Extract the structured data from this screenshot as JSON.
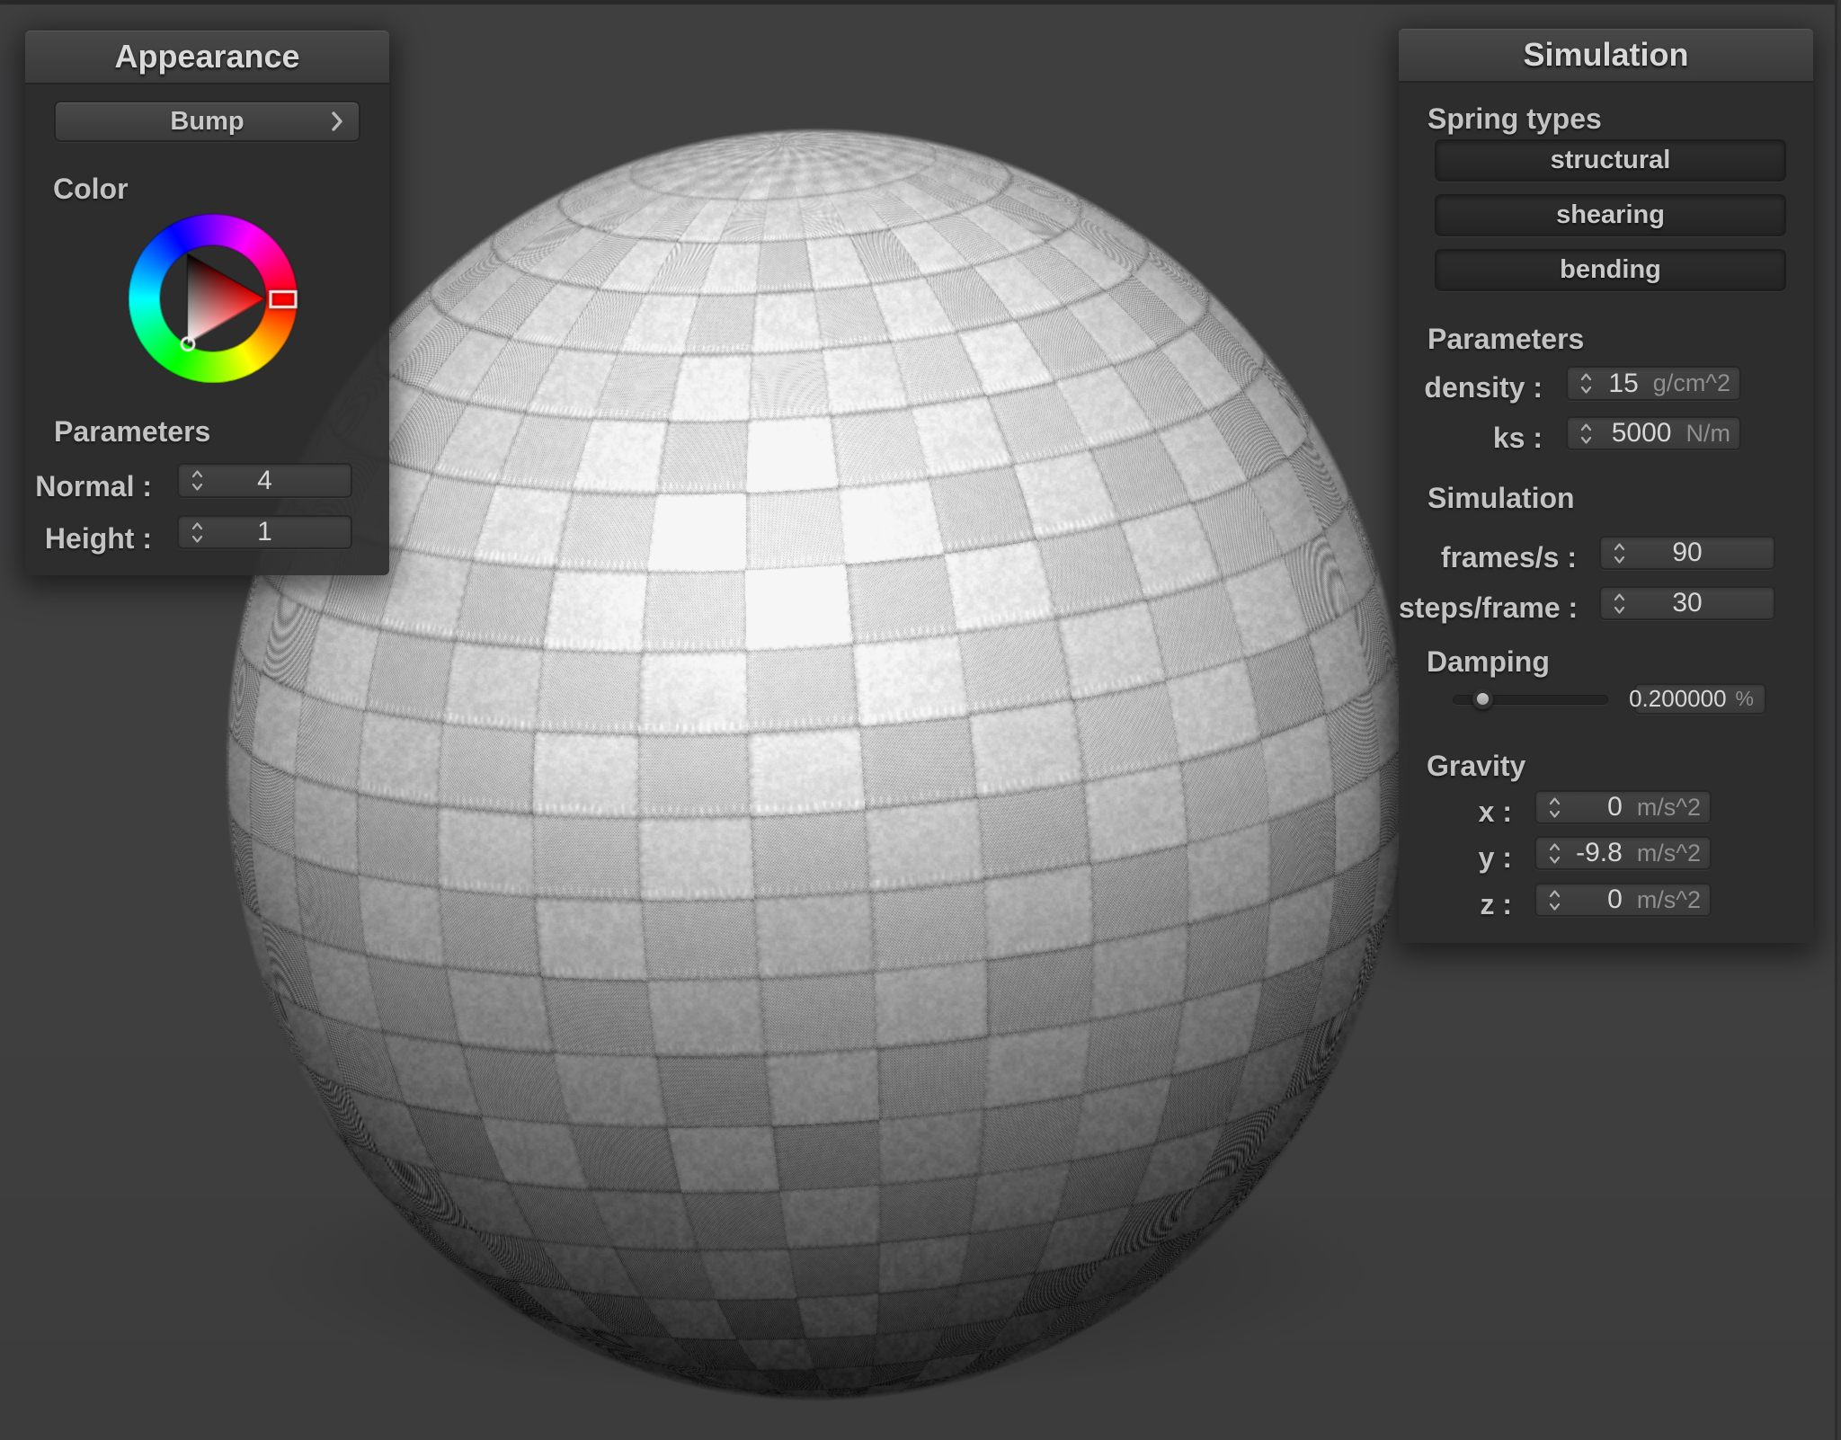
{
  "app": {
    "background_color": "#3f3f40",
    "panel_color": "#2c2c2c",
    "accent_selected_hue": "#ff0000"
  },
  "appearance": {
    "title": "Appearance",
    "bump_label": "Bump",
    "color_label": "Color",
    "params_label": "Parameters",
    "rows": [
      {
        "label": "Normal :",
        "value": "4"
      },
      {
        "label": "Height :",
        "value": "1"
      }
    ]
  },
  "simulation": {
    "title": "Simulation",
    "spring_label": "Spring types",
    "springs": [
      "structural",
      "shearing",
      "bending"
    ],
    "params_label": "Parameters",
    "params": [
      {
        "label": "density :",
        "value": "15",
        "unit": "g/cm^2"
      },
      {
        "label": "ks :",
        "value": "5000",
        "unit": "N/m"
      }
    ],
    "sim_label": "Simulation",
    "sim": [
      {
        "label": "frames/s :",
        "value": "90"
      },
      {
        "label": "steps/frame :",
        "value": "30"
      }
    ],
    "damping_label": "Damping",
    "damping": {
      "value": "0.200000",
      "unit": "%",
      "fraction": 0.2
    },
    "gravity_label": "Gravity",
    "gravity": [
      {
        "label": "x :",
        "value": "0",
        "unit": "m/s^2"
      },
      {
        "label": "y :",
        "value": "-9.8",
        "unit": "m/s^2"
      },
      {
        "label": "z :",
        "value": "0",
        "unit": "m/s^2"
      }
    ]
  }
}
